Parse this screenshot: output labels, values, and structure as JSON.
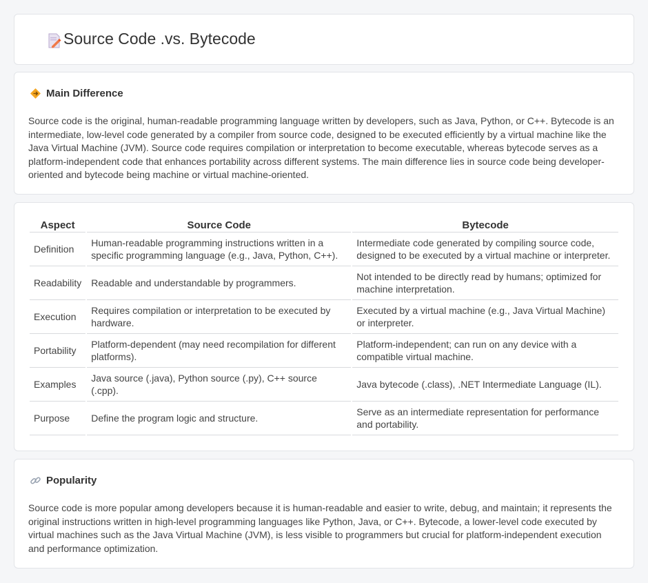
{
  "header": {
    "title": "Source Code .vs. Bytecode",
    "icon": "document-edit-icon"
  },
  "main_difference": {
    "heading": "Main Difference",
    "icon": "diamond-icon",
    "text": "Source code is the original, human-readable programming language written by developers, such as Java, Python, or C++. Bytecode is an intermediate, low-level code generated by a compiler from source code, designed to be executed efficiently by a virtual machine like the Java Virtual Machine (JVM). Source code requires compilation or interpretation to become executable, whereas bytecode serves as a platform-independent code that enhances portability across different systems. The main difference lies in source code being developer-oriented and bytecode being machine or virtual machine-oriented."
  },
  "comparison": {
    "headers": [
      "Aspect",
      "Source Code",
      "Bytecode"
    ],
    "rows": [
      [
        "Definition",
        "Human-readable programming instructions written in a specific programming language (e.g., Java, Python, C++).",
        "Intermediate code generated by compiling source code, designed to be executed by a virtual machine or interpreter."
      ],
      [
        "Readability",
        "Readable and understandable by programmers.",
        "Not intended to be directly read by humans; optimized for machine interpretation."
      ],
      [
        "Execution",
        "Requires compilation or interpretation to be executed by hardware.",
        "Executed by a virtual machine (e.g., Java Virtual Machine) or interpreter."
      ],
      [
        "Portability",
        "Platform-dependent (may need recompilation for different platforms).",
        "Platform-independent; can run on any device with a compatible virtual machine."
      ],
      [
        "Examples",
        "Java source (.java), Python source (.py), C++ source (.cpp).",
        "Java bytecode (.class), .NET Intermediate Language (IL)."
      ],
      [
        "Purpose",
        "Define the program logic and structure.",
        "Serve as an intermediate representation for performance and portability."
      ]
    ]
  },
  "popularity": {
    "heading": "Popularity",
    "icon": "link-icon",
    "text": "Source code is more popular among developers because it is human-readable and easier to write, debug, and maintain; it represents the original instructions written in high-level programming languages like Python, Java, or C++. Bytecode, a lower-level code executed by virtual machines such as the Java Virtual Machine (JVM), is less visible to programmers but crucial for platform-independent execution and performance optimization."
  }
}
